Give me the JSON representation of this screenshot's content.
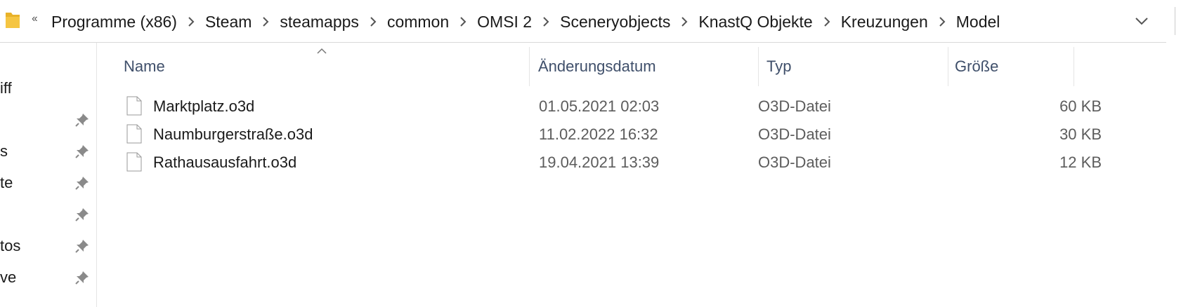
{
  "address_bar": {
    "overflow_icon": "double-chevron-left-icon",
    "breadcrumbs": [
      "Programme (x86)",
      "Steam",
      "steamapps",
      "common",
      "OMSI 2",
      "Sceneryobjects",
      "KnastQ Objekte",
      "Kreuzungen",
      "Model"
    ]
  },
  "nav_pane": {
    "items": [
      {
        "label": "iff",
        "pinned": false
      },
      {
        "label": "",
        "pinned": true
      },
      {
        "label": "s",
        "pinned": true
      },
      {
        "label": "te",
        "pinned": true
      },
      {
        "label": "",
        "pinned": true
      },
      {
        "label": "tos",
        "pinned": true
      },
      {
        "label": "ve",
        "pinned": true
      }
    ]
  },
  "file_list": {
    "columns": {
      "name": "Name",
      "date": "Änderungsdatum",
      "type": "Typ",
      "size": "Größe"
    },
    "rows": [
      {
        "name": "Marktplatz.o3d",
        "date": "01.05.2021 02:03",
        "type": "O3D-Datei",
        "size": "60 KB"
      },
      {
        "name": "Naumburgerstraße.o3d",
        "date": "11.02.2022 16:32",
        "type": "O3D-Datei",
        "size": "30 KB"
      },
      {
        "name": "Rathausausfahrt.o3d",
        "date": "19.04.2021 13:39",
        "type": "O3D-Datei",
        "size": "12 KB"
      }
    ]
  },
  "colors": {
    "folder": "#f5c542",
    "header_text": "#3f4f6a",
    "secondary_text": "#5c5c5c"
  }
}
